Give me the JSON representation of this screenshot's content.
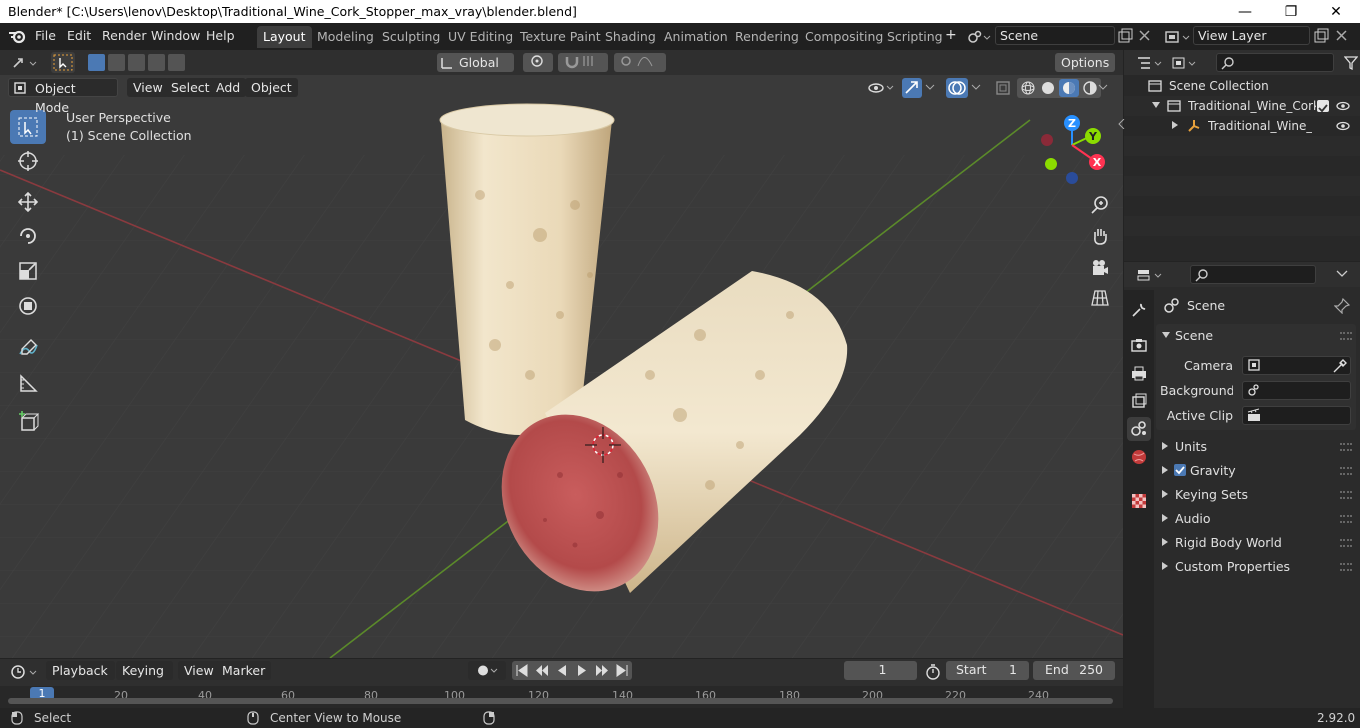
{
  "window": {
    "title": "Blender* [C:\\Users\\lenov\\Desktop\\Traditional_Wine_Cork_Stopper_max_vray\\blender.blend]",
    "min_glyph": "—",
    "max_glyph": "❐",
    "close_glyph": "✕"
  },
  "menu": [
    "File",
    "Edit",
    "Render",
    "Window",
    "Help"
  ],
  "workspaces": [
    "Layout",
    "Modeling",
    "Sculpting",
    "UV Editing",
    "Texture Paint",
    "Shading",
    "Animation",
    "Rendering",
    "Compositing",
    "Scripting"
  ],
  "active_workspace": "Layout",
  "add_workspace": "+",
  "scene_field": "Scene",
  "view_layer_field": "View Layer",
  "tool_header": {
    "orientation": "Global",
    "options": "Options"
  },
  "viewport_header": {
    "mode": "Object Mode",
    "menus": [
      "View",
      "Select",
      "Add",
      "Object"
    ]
  },
  "viewport": {
    "perspective": "User Perspective",
    "collection": "(1) Scene Collection",
    "gizmo": {
      "z": "Z",
      "y": "Y",
      "x": "X"
    }
  },
  "outliner": {
    "rows": [
      {
        "label": "Scene Collection"
      },
      {
        "label": "Traditional_Wine_Cork_S"
      },
      {
        "label": "Traditional_Wine_Co"
      }
    ]
  },
  "properties": {
    "context": "Scene",
    "panel_title": "Scene",
    "fields": [
      {
        "label": "Camera"
      },
      {
        "label": "Background ..."
      },
      {
        "label": "Active Clip"
      }
    ],
    "subpanels": [
      "Units",
      "Gravity",
      "Keying Sets",
      "Audio",
      "Rigid Body World",
      "Custom Properties"
    ],
    "gravity_checked": true
  },
  "timeline": {
    "menus": [
      "Playback",
      "Keying",
      "View",
      "Marker"
    ],
    "current_frame": "1",
    "start_label": "Start",
    "start": "1",
    "end_label": "End",
    "end": "250",
    "ticks": [
      "1",
      "20",
      "40",
      "60",
      "80",
      "100",
      "120",
      "140",
      "160",
      "180",
      "200",
      "220",
      "240"
    ]
  },
  "status": {
    "select": "Select",
    "center": "Center View to Mouse",
    "version": "2.92.0"
  },
  "colors": {
    "accent": "#4b79b4",
    "x_axis": "#ff3352",
    "y_axis": "#8bdc00",
    "z_axis": "#2890ff"
  }
}
